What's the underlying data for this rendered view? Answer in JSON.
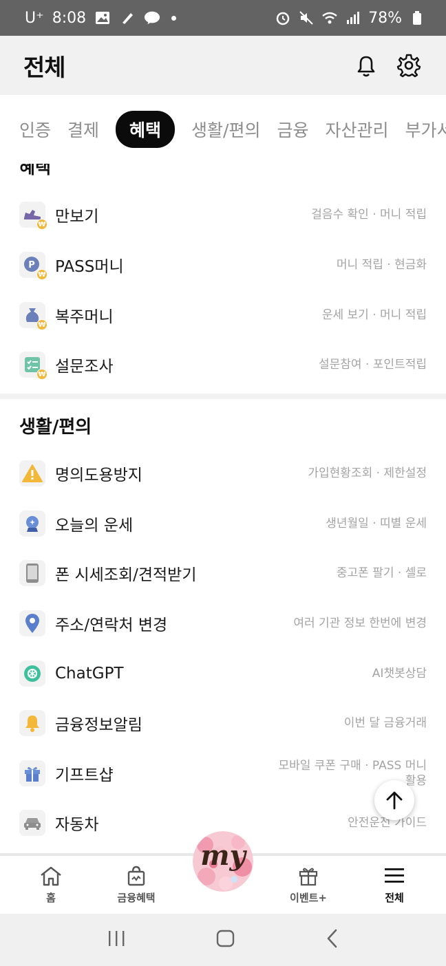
{
  "status_bar": {
    "carrier": "U⁺",
    "time": "8:08",
    "battery": "78%"
  },
  "header": {
    "title": "전체"
  },
  "tabs": [
    {
      "label": "인증"
    },
    {
      "label": "결제"
    },
    {
      "label": "혜택"
    },
    {
      "label": "생활/편의"
    },
    {
      "label": "금융"
    },
    {
      "label": "자산관리"
    },
    {
      "label": "부가서"
    }
  ],
  "sections": {
    "benefit": {
      "title": "혜택",
      "items": [
        {
          "name": "만보기",
          "desc": "걸음수 확인 · 머니 적립",
          "icon": "shoe-icon"
        },
        {
          "name": "PASS머니",
          "desc": "머니 적립 · 현금화",
          "icon": "pass-coin-icon"
        },
        {
          "name": "복주머니",
          "desc": "운세 보기 · 머니 적립",
          "icon": "lucky-bag-icon"
        },
        {
          "name": "설문조사",
          "desc": "설문참여 · 포인트적립",
          "icon": "survey-icon"
        }
      ]
    },
    "life": {
      "title": "생활/편의",
      "items": [
        {
          "name": "명의도용방지",
          "desc": "가입현황조회 · 제한설정",
          "icon": "warning-icon"
        },
        {
          "name": "오늘의 운세",
          "desc": "생년월일 · 띠별 운세",
          "icon": "crystal-ball-icon"
        },
        {
          "name": "폰 시세조회/견적받기",
          "desc": "중고폰 팔기 · 셀로",
          "icon": "phone-icon"
        },
        {
          "name": "주소/연락처 변경",
          "desc": "여러 기관 정보 한번에 변경",
          "icon": "location-pin-icon"
        },
        {
          "name": "ChatGPT",
          "desc": "AI챗봇상담",
          "icon": "chatgpt-icon"
        },
        {
          "name": "금융정보알림",
          "desc": "이번 달 금융거래",
          "icon": "bell-icon"
        },
        {
          "name": "기프트샵",
          "desc_line1": "모바일 쿠폰 구매 · PASS 머니",
          "desc_line2": "활용",
          "icon": "gift-icon"
        },
        {
          "name": "자동차",
          "desc": "안전운전 가이드",
          "icon": "car-icon"
        }
      ]
    }
  },
  "bottom_nav": {
    "home": "홈",
    "finance_benefit": "금융혜택",
    "my": "my",
    "event": "이벤트+",
    "all": "전체"
  },
  "colors": {
    "accent_dark": "#0b0b0b",
    "coin": "#f3b73a",
    "muted_text": "#a3a3a3"
  }
}
